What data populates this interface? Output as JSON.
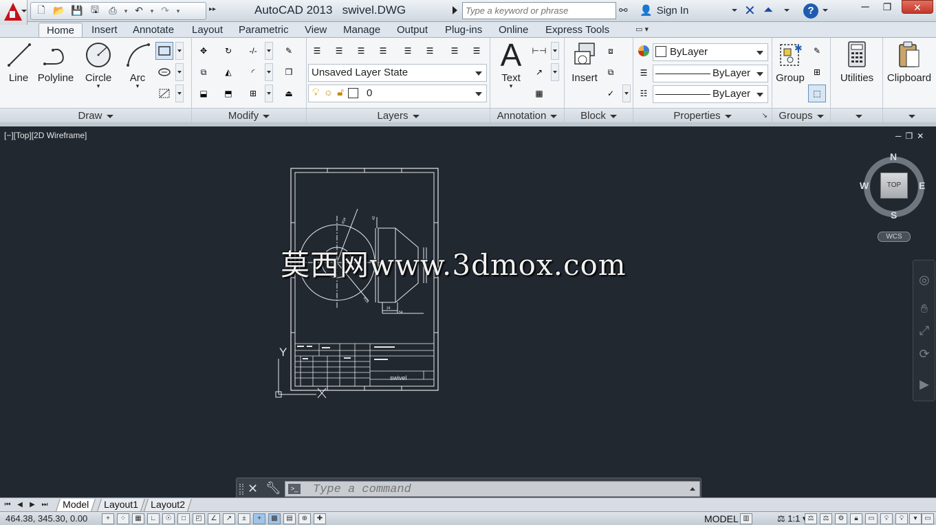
{
  "app": {
    "title": "AutoCAD 2013",
    "document": "swivel.DWG",
    "search_placeholder": "Type a keyword or phrase",
    "sign_in": "Sign In",
    "help": "?"
  },
  "ribbon_tabs": [
    "Home",
    "Insert",
    "Annotate",
    "Layout",
    "Parametric",
    "View",
    "Manage",
    "Output",
    "Plug-ins",
    "Online",
    "Express Tools"
  ],
  "panels": {
    "draw": {
      "label": "Draw",
      "tools": {
        "line": "Line",
        "polyline": "Polyline",
        "circle": "Circle",
        "arc": "Arc"
      }
    },
    "modify": {
      "label": "Modify"
    },
    "layers": {
      "label": "Layers",
      "layer_state": "Unsaved Layer State",
      "current_layer": "0"
    },
    "annotation": {
      "label": "Annotation",
      "text": "Text"
    },
    "block": {
      "label": "Block",
      "insert": "Insert"
    },
    "properties": {
      "label": "Properties",
      "color": "ByLayer",
      "linetype": "ByLayer",
      "lineweight": "ByLayer"
    },
    "groups": {
      "label": "Groups",
      "group": "Group"
    },
    "utilities": {
      "label": "Utilities"
    },
    "clipboard": {
      "label": "Clipboard"
    }
  },
  "viewport": {
    "label": "[−][Top][2D Wireframe]",
    "viewcube": {
      "top_face": "TOP",
      "north": "N",
      "south": "S",
      "east": "E",
      "west": "W",
      "wcs": "WCS"
    },
    "watermark": "莫西网www.3dmox.com",
    "drawing_title_block": "swivel",
    "ucs_y": "Y",
    "ucs_x": "X"
  },
  "command_line": {
    "placeholder": "Type a command"
  },
  "layout_tabs": [
    "Model",
    "Layout1",
    "Layout2"
  ],
  "status_bar": {
    "coordinates": "464.38, 345.30, 0.00",
    "space": "MODEL",
    "annotation_scale": "1:1"
  },
  "colors": {
    "drawing_bg": "#212830",
    "ribbon_bg": "#f4f6f8",
    "accent": "#1f5cb0",
    "logo_red": "#c8101a"
  }
}
